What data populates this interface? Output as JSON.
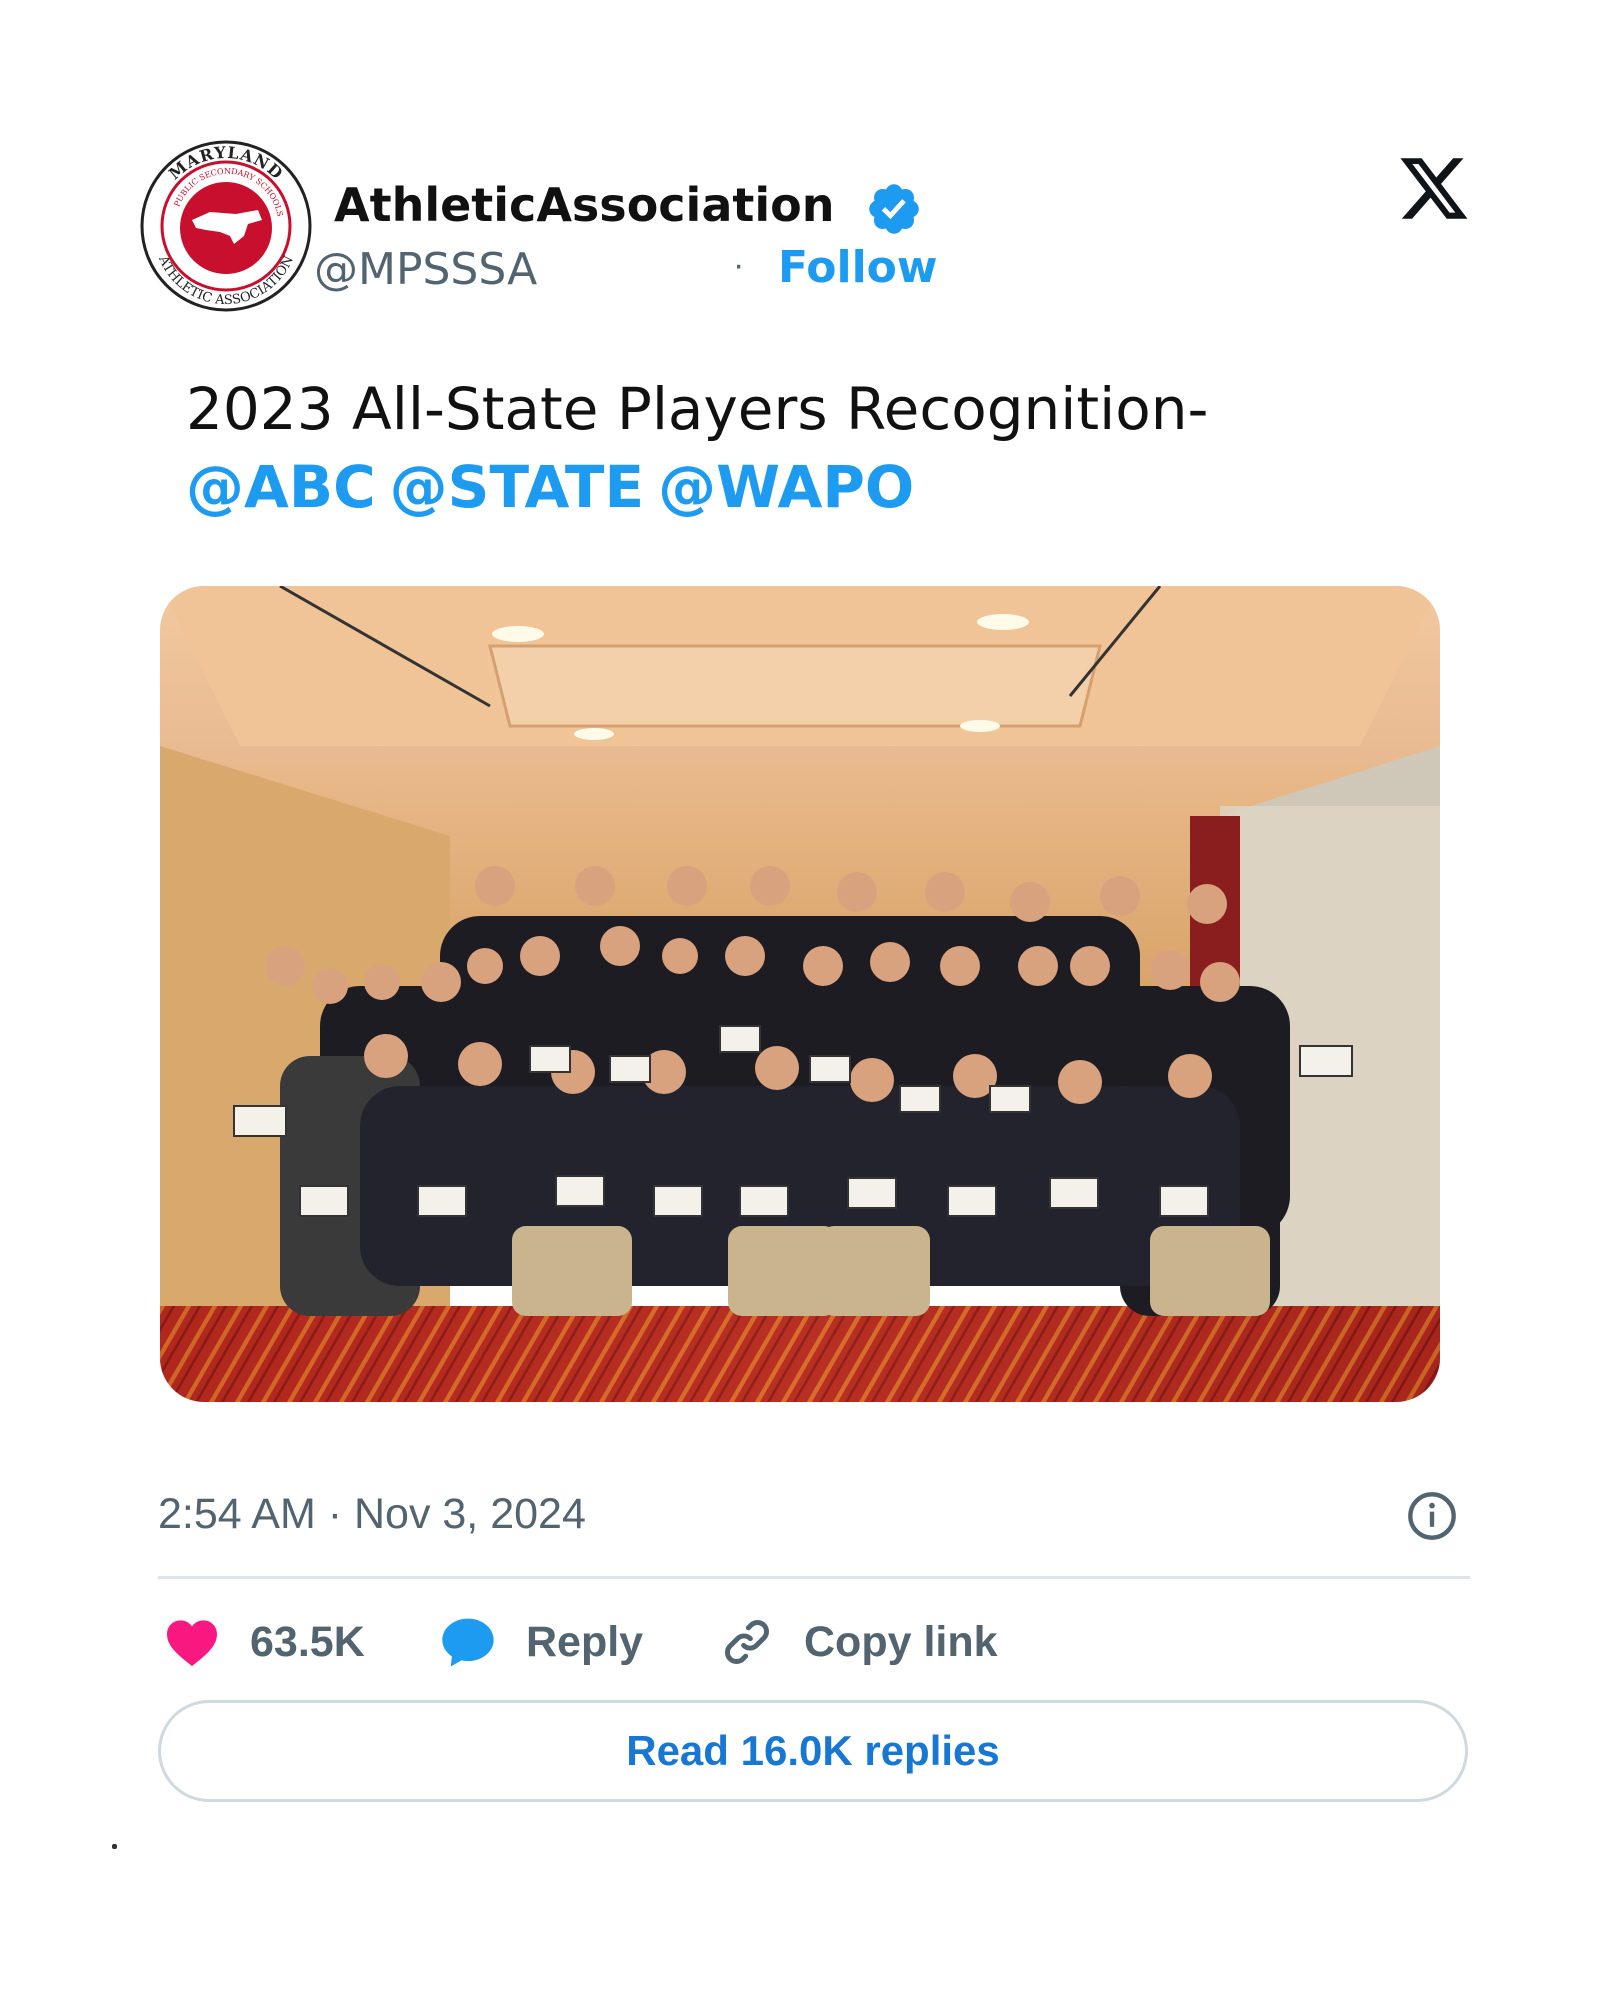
{
  "author": {
    "display_name": "AthleticAssociation",
    "handle": "@MPSSSA",
    "separator": "·",
    "follow_label": "Follow",
    "verified": true,
    "avatar_ring_text_top": "MARYLAND",
    "avatar_ring_text_inner": "PUBLIC SECONDARY SCHOOLS",
    "avatar_ring_text_bottom": "ATHLETIC ASSOCIATION"
  },
  "tweet": {
    "text": "2023 All-State Players Recognition-",
    "mentions": [
      "@ABC",
      "@STATE",
      "@WAPO"
    ]
  },
  "photo": {
    "content": "group-photo"
  },
  "meta": {
    "timestamp": "2:54 AM · Nov 3, 2024"
  },
  "actions": {
    "likes": "63.5K",
    "reply_label": "Reply",
    "copy_label": "Copy link",
    "read_replies_label": "Read 16.0K replies"
  },
  "colors": {
    "accent": "#1d9bf0",
    "like": "#f91880",
    "secondary_text": "#536471",
    "logo_red": "#c8102e"
  },
  "icons": [
    "verified-badge-icon",
    "x-logo-icon",
    "info-icon",
    "heart-icon",
    "reply-bubble-icon",
    "link-icon"
  ]
}
